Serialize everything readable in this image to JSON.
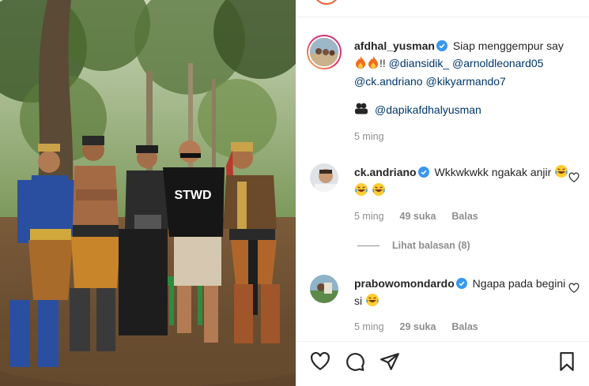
{
  "post": {
    "author": "afdhal_yusman",
    "caption_text": "Siap menggempur say",
    "caption_suffix": "!!",
    "mentions": [
      "@diansidik_",
      "@arnoldleonard05",
      "@ck.andriano",
      "@kikyarmando7"
    ],
    "tagged_account": "@dapikafdhalyusman",
    "time_ago": "5 ming"
  },
  "comments": [
    {
      "username": "ck.andriano",
      "text": "Wkkwkwkk ngakak anjir",
      "time_ago": "5 ming",
      "likes": "49 suka",
      "reply_label": "Balas",
      "view_replies": "Lihat balasan (8)"
    },
    {
      "username": "prabowomondardo",
      "text": "Ngapa pada begini si",
      "time_ago": "5 ming",
      "likes": "29 suka",
      "reply_label": "Balas"
    }
  ],
  "photo": {
    "shirt_text": "STWD"
  },
  "icons": {
    "verified": "verified-badge-icon",
    "heart": "heart-icon",
    "comment": "comment-icon",
    "share": "share-icon",
    "save": "bookmark-icon",
    "fire": "fire-emoji-icon",
    "laugh": "laughing-emoji-icon",
    "tag": "tagged-user-icon"
  },
  "colors": {
    "verified_blue": "#3897f0",
    "mention_blue": "#00376b",
    "muted_text": "#8e8e8e"
  }
}
